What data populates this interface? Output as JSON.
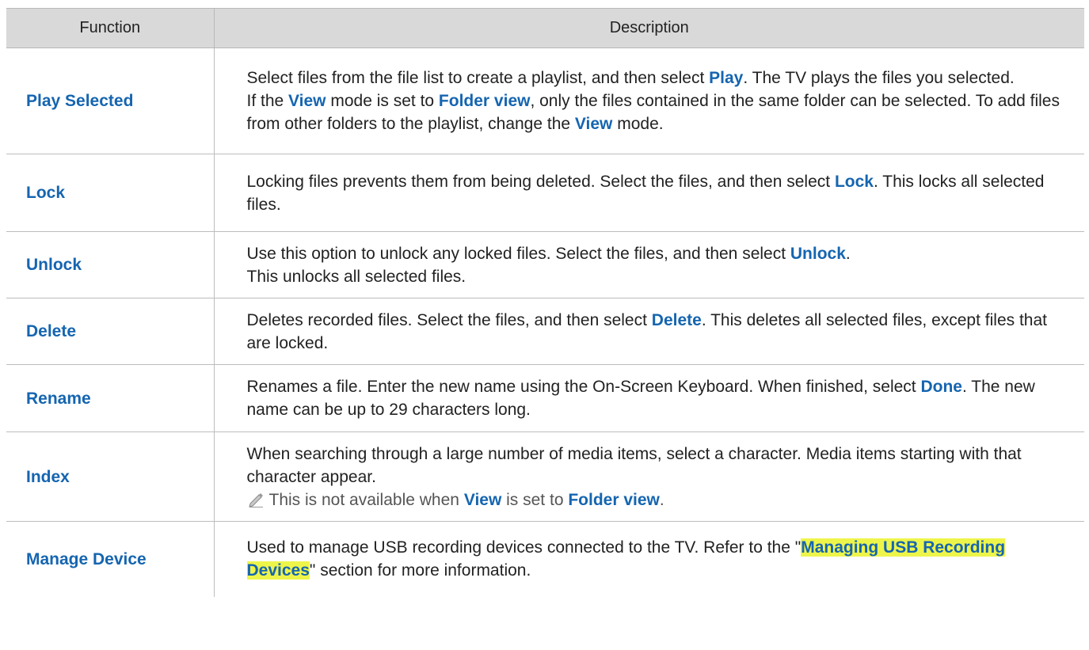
{
  "header": {
    "function": "Function",
    "description": "Description"
  },
  "rows": [
    {
      "function": "Play Selected",
      "lines": [
        [
          {
            "t": "Select files from the file list to create a playlist, and then select "
          },
          {
            "t": "Play",
            "k": 1
          },
          {
            "t": ". The TV plays the files you selected."
          }
        ],
        [
          {
            "t": "If the "
          },
          {
            "t": "View",
            "k": 1
          },
          {
            "t": " mode is set to "
          },
          {
            "t": "Folder view",
            "k": 1
          },
          {
            "t": ", only the files contained in the same folder can be selected. To add files from other folders to the playlist, change the "
          },
          {
            "t": "View",
            "k": 1
          },
          {
            "t": " mode."
          }
        ]
      ]
    },
    {
      "function": "Lock",
      "lines": [
        [
          {
            "t": "Locking files prevents them from being deleted. Select the files, and then select "
          },
          {
            "t": "Lock",
            "k": 1
          },
          {
            "t": ". This locks all selected files."
          }
        ]
      ]
    },
    {
      "function": "Unlock",
      "lines": [
        [
          {
            "t": "Use this option to unlock any locked files. Select the files, and then select "
          },
          {
            "t": "Unlock",
            "k": 1
          },
          {
            "t": "."
          }
        ],
        [
          {
            "t": "This unlocks all selected files."
          }
        ]
      ]
    },
    {
      "function": "Delete",
      "lines": [
        [
          {
            "t": "Deletes recorded files. Select the files, and then select "
          },
          {
            "t": "Delete",
            "k": 1
          },
          {
            "t": ". This deletes all selected files, except files that are locked."
          }
        ]
      ]
    },
    {
      "function": "Rename",
      "lines": [
        [
          {
            "t": "Renames a file. Enter the new name using the On-Screen Keyboard. When finished, select "
          },
          {
            "t": "Done",
            "k": 1
          },
          {
            "t": ". The new name can be up to 29 characters long."
          }
        ]
      ]
    },
    {
      "function": "Index",
      "lines": [
        [
          {
            "t": "When searching through a large number of media items, select a character. Media items starting with that character appear."
          }
        ],
        [
          {
            "note": 1
          },
          {
            "t": "This is not available when "
          },
          {
            "t": "View",
            "k": 1
          },
          {
            "t": " is set to "
          },
          {
            "t": "Folder view",
            "k": 1
          },
          {
            "t": "."
          }
        ]
      ]
    },
    {
      "function": "Manage Device",
      "lines": [
        [
          {
            "t": "Used to manage USB recording devices connected to the TV. Refer to the \""
          },
          {
            "t": "Managing USB Recording Devices",
            "h": 1
          },
          {
            "t": "\" section for more information."
          }
        ]
      ]
    }
  ],
  "note_icon": "pencil-icon",
  "colors": {
    "keyword": "#1565b0",
    "header_bg": "#d9d9d9",
    "highlight": "#eef54a"
  }
}
